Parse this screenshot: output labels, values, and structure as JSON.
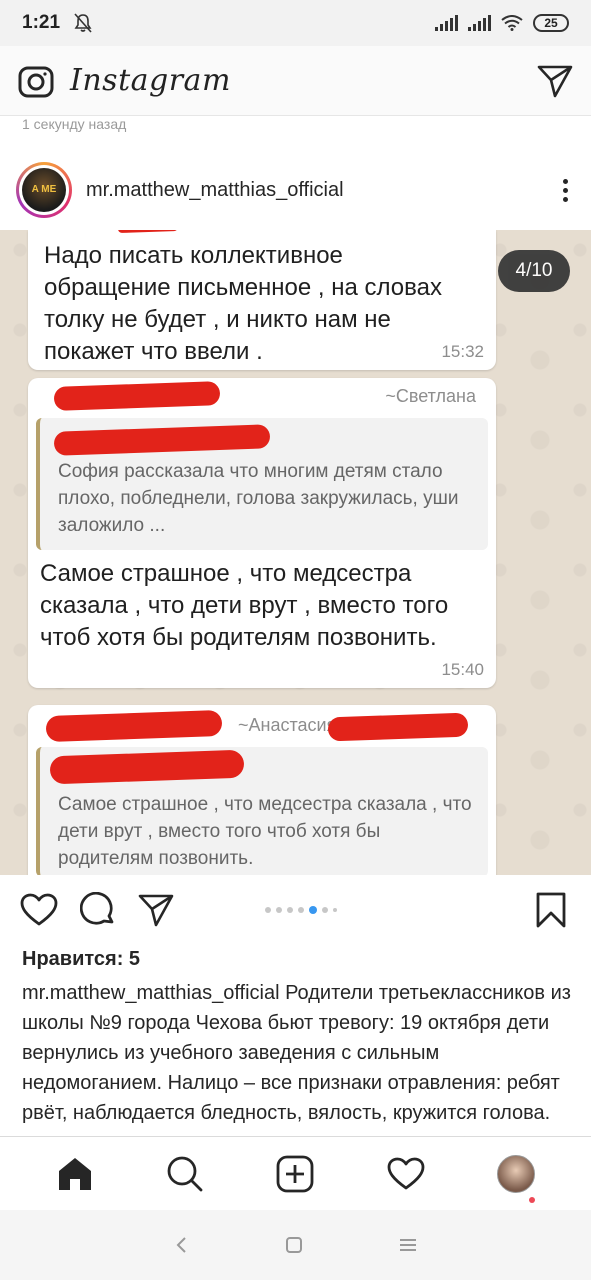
{
  "status_bar": {
    "time": "1:21",
    "battery": "25"
  },
  "top_bar": {
    "app_title": "Instagram"
  },
  "time_ago": "1 секунду назад",
  "post": {
    "username": "mr.matthew_matthias_official",
    "avatar_text": "A ME",
    "counter": "4/10",
    "chat": {
      "message1": "Надо писать коллективное обращение письменное , на словах толку не будет , и никто нам не покажет что ввели .",
      "message1_time": "15:32",
      "message2_sender": "~Светлана",
      "message2_quote": "София рассказала что многим детям стало плохо, побледнели, голова закружилась, уши заложило ...",
      "message2_text": "Самое страшное , что медсестра сказала , что дети врут , вместо того чтоб хотя бы родителям позвонить.",
      "message2_time": "15:40",
      "message3_sender": "~Анастасия",
      "message3_quote": "Самое страшное , что медсестра сказала , что дети врут , вместо того чтоб хотя бы родителям позвонить."
    },
    "carousel": {
      "total": 7,
      "active_index": 4
    },
    "likes": "Нравится: 5",
    "caption_user": "mr.matthew_matthias_official",
    "caption_text": " Родители третьеклассников из школы №9 города Чехова бьют тревогу: 19 октября дети вернулись из учебного заведения с сильным недомоганием. Налицо – все признаки отравления: ребят рвёт, наблюдается бледность, вялость, кружится голова."
  },
  "icons": {
    "camera": "camera-icon",
    "send": "send-icon",
    "more": "more-vertical-icon",
    "heart": "heart-icon",
    "comment": "comment-icon",
    "share": "share-icon",
    "bookmark": "bookmark-icon",
    "home": "home-icon",
    "search": "search-icon",
    "add": "add-post-icon",
    "activity": "activity-heart-icon"
  },
  "colors": {
    "notification_dot": "#ed4956",
    "carousel_active": "#3897f0",
    "redaction": "#e2231a"
  }
}
